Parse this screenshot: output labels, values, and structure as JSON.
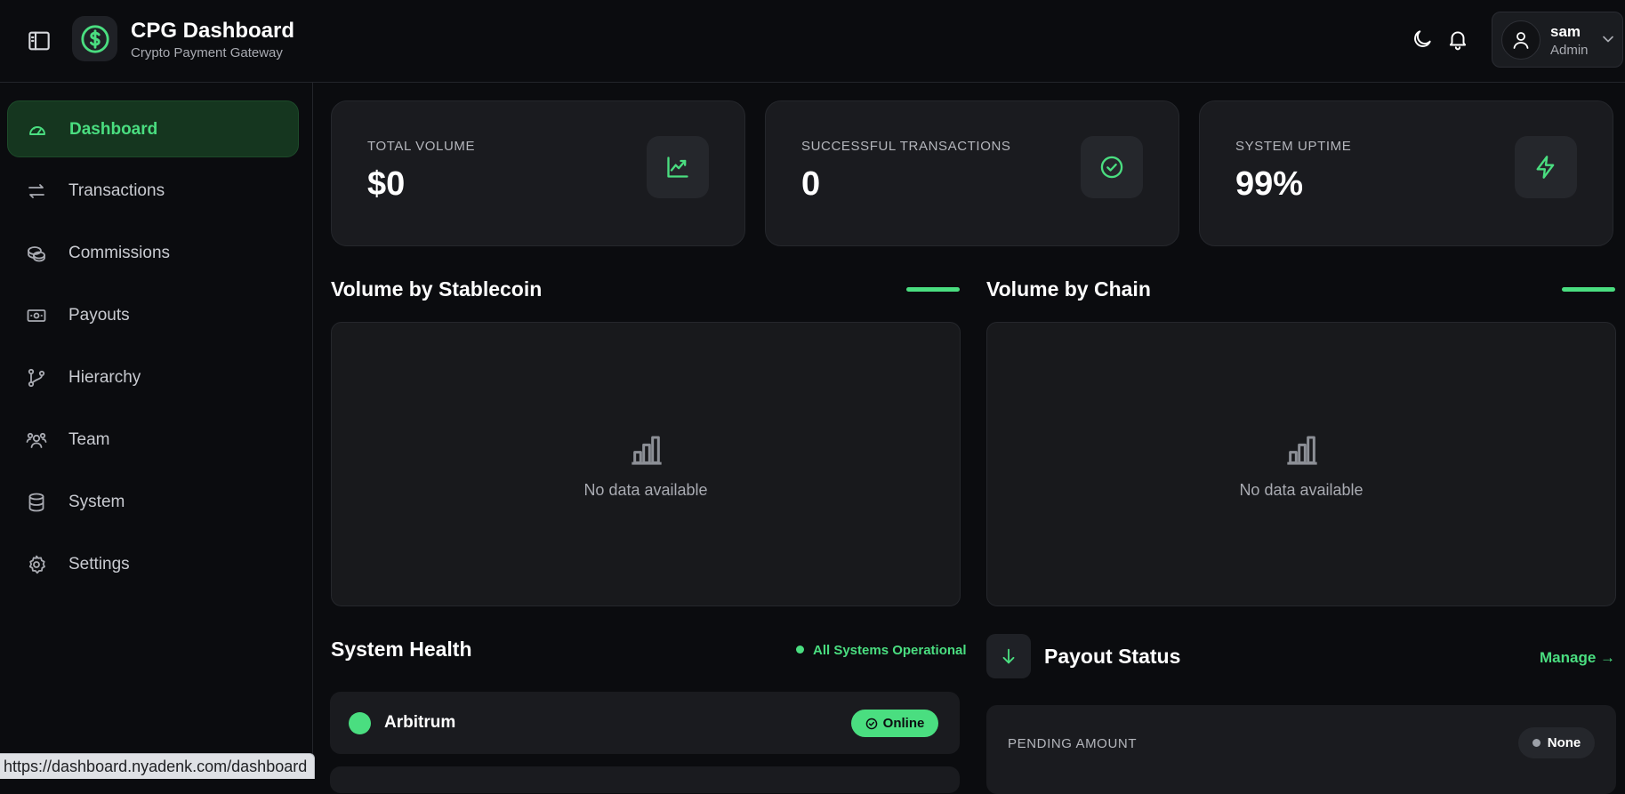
{
  "header": {
    "title": "CPG Dashboard",
    "subtitle": "Crypto Payment Gateway",
    "user": {
      "name": "sam",
      "role": "Admin"
    }
  },
  "sidebar": {
    "items": [
      {
        "label": "Dashboard",
        "icon": "gauge-icon",
        "active": true
      },
      {
        "label": "Transactions",
        "icon": "arrows-left-right-icon"
      },
      {
        "label": "Commissions",
        "icon": "coins-icon"
      },
      {
        "label": "Payouts",
        "icon": "banknote-icon"
      },
      {
        "label": "Hierarchy",
        "icon": "git-branch-icon"
      },
      {
        "label": "Team",
        "icon": "users-icon"
      },
      {
        "label": "System",
        "icon": "database-icon"
      },
      {
        "label": "Settings",
        "icon": "gear-icon"
      }
    ]
  },
  "stats": [
    {
      "label": "TOTAL VOLUME",
      "value": "$0",
      "icon": "trending-up-icon"
    },
    {
      "label": "SUCCESSFUL TRANSACTIONS",
      "value": "0",
      "icon": "check-circle-icon"
    },
    {
      "label": "SYSTEM UPTIME",
      "value": "99%",
      "icon": "zap-icon"
    }
  ],
  "charts": {
    "stablecoin": {
      "title": "Volume by Stablecoin",
      "empty_text": "No data available"
    },
    "chain": {
      "title": "Volume by Chain",
      "empty_text": "No data available"
    }
  },
  "system_health": {
    "title": "System Health",
    "status": "All Systems Operational",
    "rows": [
      {
        "chain": "Arbitrum",
        "status": "Online"
      }
    ]
  },
  "payout_status": {
    "title": "Payout Status",
    "manage_label": "Manage →",
    "pending_label": "PENDING AMOUNT",
    "pending_badge": "None"
  },
  "status_bar": {
    "url": "https://dashboard.nyadenk.com/dashboard"
  },
  "colors": {
    "accent": "#4ade80",
    "background": "#0b0c0f",
    "card": "#1a1b1f"
  }
}
